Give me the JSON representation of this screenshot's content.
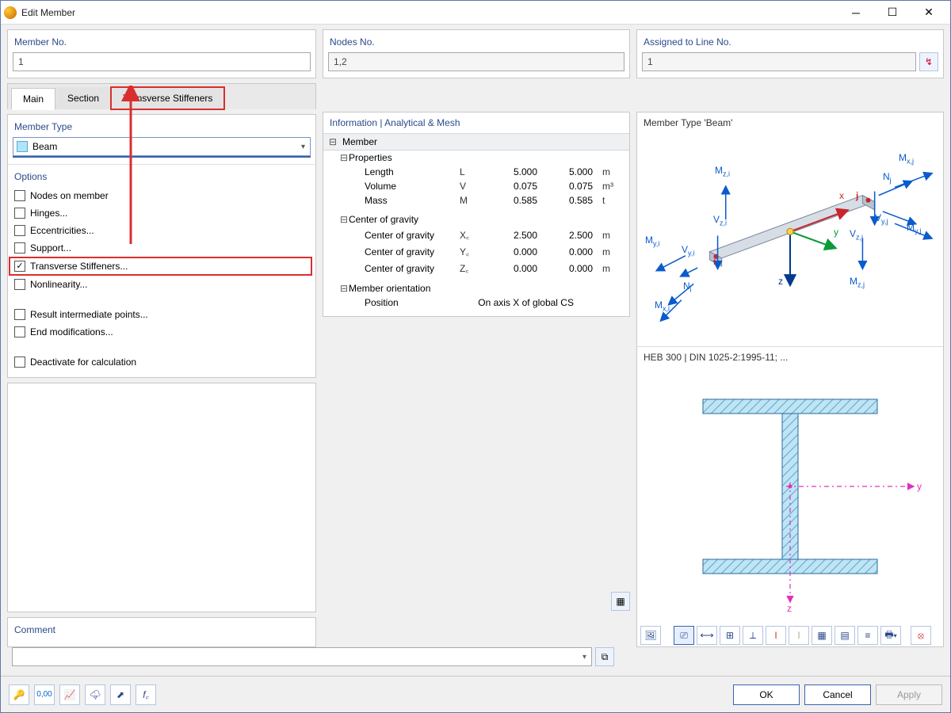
{
  "window": {
    "title": "Edit Member"
  },
  "header": {
    "member_no_label": "Member No.",
    "member_no_value": "1",
    "assigned_label": "Assigned to Line No.",
    "assigned_value": "1"
  },
  "tabs": [
    {
      "label": "Main",
      "active": true
    },
    {
      "label": "Section"
    },
    {
      "label": "Transverse Stiffeners",
      "highlight": true
    }
  ],
  "member_type": {
    "label": "Member Type",
    "value": "Beam"
  },
  "options": {
    "label": "Options",
    "items": [
      {
        "label": "Nodes on member",
        "checked": false
      },
      {
        "label": "Hinges...",
        "checked": false
      },
      {
        "label": "Eccentricities...",
        "checked": false
      },
      {
        "label": "Support...",
        "checked": false
      },
      {
        "label": "Transverse Stiffeners...",
        "checked": true,
        "highlight": true
      },
      {
        "label": "Nonlinearity...",
        "checked": false
      },
      {
        "gap": true
      },
      {
        "label": "Result intermediate points...",
        "checked": false
      },
      {
        "label": "End modifications...",
        "checked": false
      },
      {
        "gap": true
      },
      {
        "label": "Deactivate for calculation",
        "checked": false
      }
    ]
  },
  "nodes": {
    "label": "Nodes No.",
    "value": "1,2"
  },
  "info": {
    "header": "Information | Analytical & Mesh",
    "member_label": "Member",
    "properties_label": "Properties",
    "properties": [
      {
        "name": "Length",
        "sym": "L",
        "a": "5.000",
        "b": "5.000",
        "unit": "m"
      },
      {
        "name": "Volume",
        "sym": "V",
        "a": "0.075",
        "b": "0.075",
        "unit": "m³"
      },
      {
        "name": "Mass",
        "sym": "M",
        "a": "0.585",
        "b": "0.585",
        "unit": "t"
      }
    ],
    "cog_label": "Center of gravity",
    "cog": [
      {
        "name": "Center of gravity",
        "sym": "X꜀",
        "a": "2.500",
        "b": "2.500",
        "unit": "m"
      },
      {
        "name": "Center of gravity",
        "sym": "Y꜀",
        "a": "0.000",
        "b": "0.000",
        "unit": "m"
      },
      {
        "name": "Center of gravity",
        "sym": "Z꜀",
        "a": "0.000",
        "b": "0.000",
        "unit": "m"
      }
    ],
    "orient_label": "Member orientation",
    "orient_row": {
      "name": "Position",
      "value": "On axis X of global CS"
    }
  },
  "preview": {
    "title": "Member Type 'Beam'",
    "forces": {
      "Mzi": "M",
      "Mzi_sub": "z,i",
      "Vzi": "V",
      "Vzi_sub": "z,i",
      "Myi": "M",
      "Myi_sub": "y,i",
      "Vyi": "V",
      "Vyi_sub": "y,i",
      "Ni": "N",
      "Ni_sub": "i",
      "Mxi": "M",
      "Mxi_sub": "x,i",
      "Mxj": "M",
      "Mxj_sub": "x,j",
      "Nj": "N",
      "Nj_sub": "j",
      "Vyj": "V",
      "Vyj_sub": "y,j",
      "Myj": "M",
      "Myj_sub": "y,j",
      "Vzj": "V",
      "Vzj_sub": "z,j",
      "Mzj": "M",
      "Mzj_sub": "z,j",
      "y": "y",
      "z": "z",
      "x": "x",
      "i": "i",
      "j": "j"
    }
  },
  "section": {
    "title": "HEB 300 | DIN 1025-2:1995-11; ...",
    "y": "y",
    "z": "z"
  },
  "comment": {
    "label": "Comment",
    "value": ""
  },
  "buttons": {
    "ok": "OK",
    "cancel": "Cancel",
    "apply": "Apply"
  }
}
